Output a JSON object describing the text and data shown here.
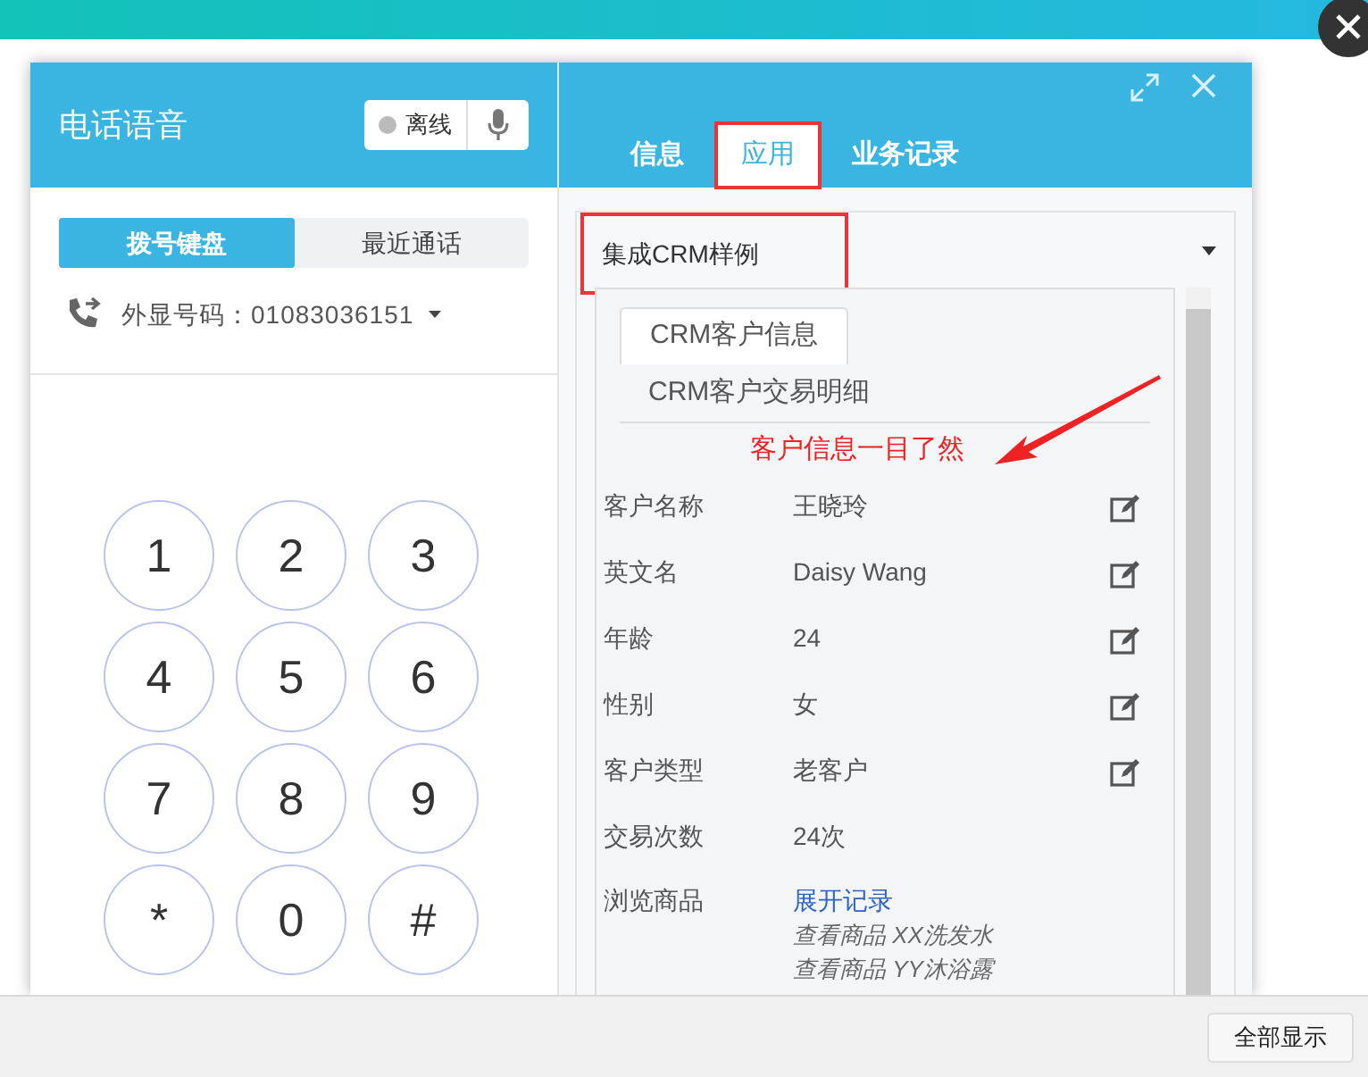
{
  "header": {
    "title": "电话语音",
    "status": "离线",
    "online": false
  },
  "left_tabs": [
    {
      "label": "拨号键盘",
      "selected": true
    },
    {
      "label": "最近通话",
      "selected": false
    }
  ],
  "caller_id": "外显号码：01083036151",
  "keypad": [
    "1",
    "2",
    "3",
    "4",
    "5",
    "6",
    "7",
    "8",
    "9",
    "*",
    "0",
    "#"
  ],
  "right_tabs": [
    {
      "label": "信息",
      "selected": false
    },
    {
      "label": "应用",
      "selected": true
    },
    {
      "label": "业务记录",
      "selected": false
    }
  ],
  "app_select": "集成CRM样例",
  "crm_tabs": [
    {
      "label": "CRM客户信息",
      "selected": true
    },
    {
      "label": "CRM客户交易明细",
      "selected": false
    }
  ],
  "annotation": "客户信息一目了然",
  "fields": [
    {
      "kind": "text",
      "label": "客户名称",
      "value": "王晓玲",
      "editable": true
    },
    {
      "kind": "text",
      "label": "英文名",
      "value": "Daisy Wang",
      "editable": true
    },
    {
      "kind": "text",
      "label": "年龄",
      "value": "24",
      "editable": true
    },
    {
      "kind": "text",
      "label": "性别",
      "value": "女",
      "editable": true
    },
    {
      "kind": "text",
      "label": "客户类型",
      "value": "老客户",
      "editable": true
    },
    {
      "kind": "text",
      "label": "交易次数",
      "value": "24次",
      "editable": false
    },
    {
      "kind": "records",
      "label": "浏览商品",
      "link": "展开记录",
      "records": [
        "查看商品 XX洗发水",
        "查看商品 YY沐浴露"
      ]
    }
  ],
  "show_all_button": "全部显示"
}
